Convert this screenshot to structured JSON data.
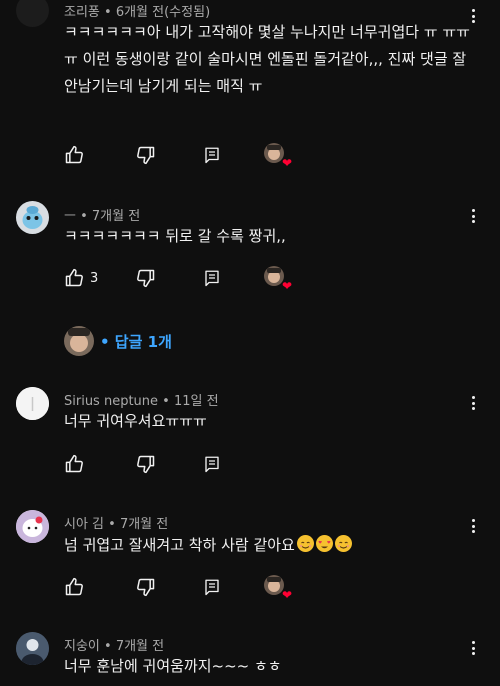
{
  "comments": [
    {
      "author": "조리퐁",
      "time": "6개월 전(수정됨)",
      "text": "ㅋㅋㅋㅋㅋㅋ아 내가 고작해야 몇살 누나지만 너무귀엽다 ㅠ ㅠㅠㅠ 이런 동생이랑 같이 술마시면 엔돌핀 돌거같아,,, 진짜 댓글 잘 안남기는데 남기게 되는 매직 ㅠ",
      "likes": "",
      "hearted": true
    },
    {
      "author": "ㅡ",
      "time": "7개월 전",
      "text": "ㅋㅋㅋㅋㅋㅋㅋ 뒤로 갈 수록 짱귀,,",
      "likes": "3",
      "hearted": true,
      "replies_label": "• 답글 1개"
    },
    {
      "author": "Sirius neptune",
      "time": "11일 전",
      "text": "너무 귀여우셔요ㅠㅠㅠ",
      "likes": "",
      "hearted": false
    },
    {
      "author": "시아 김",
      "time": "7개월 전",
      "text": "넘 귀엽고 잘새겨고 착하 사람 같아요",
      "emojis": [
        "smiling-face-emoji",
        "heart-eyes-emoji",
        "smiling-face-emoji"
      ],
      "likes": "",
      "hearted": true
    },
    {
      "author": "지숭이",
      "time": "7개월 전",
      "text": "너무 훈남에 귀여움까지~~~ ㅎㅎ",
      "likes": "",
      "hearted": false
    }
  ],
  "meta_separator": " • ",
  "colors": {
    "background": "#0f0f0f",
    "text": "#f1f1f1",
    "meta": "#aaaaaa",
    "link": "#3ea6ff",
    "heart": "#ff0033"
  },
  "icons": [
    "thumb-up-icon",
    "thumb-down-icon",
    "reply-icon",
    "more-vert-icon",
    "creator-heart-icon"
  ]
}
